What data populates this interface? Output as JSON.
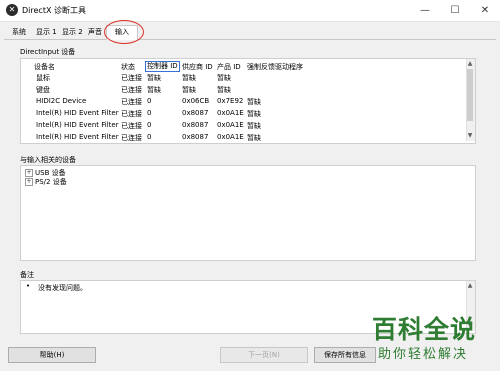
{
  "window": {
    "title": "DirectX 诊断工具",
    "minimize": "—",
    "maximize": "☐",
    "close": "✕"
  },
  "tabs": [
    {
      "label": "系统"
    },
    {
      "label": "显示 1"
    },
    {
      "label": "显示 2"
    },
    {
      "label": "声音"
    },
    {
      "label": "输入"
    }
  ],
  "directinput": {
    "group_title": "DirectInput 设备",
    "columns": [
      "设备名",
      "状态",
      "控制器 ID",
      "供应商 ID",
      "产品 ID",
      "强制反馈驱动程序"
    ],
    "rows": [
      [
        "鼠标",
        "已连接",
        "暂缺",
        "暂缺",
        "暂缺",
        ""
      ],
      [
        "键盘",
        "已连接",
        "暂缺",
        "暂缺",
        "暂缺",
        ""
      ],
      [
        "HIDI2C Device",
        "已连接",
        "0",
        "0x06CB",
        "0x7E92",
        "暂缺"
      ],
      [
        "Intel(R) HID Event Filter",
        "已连接",
        "0",
        "0x8087",
        "0x0A1E",
        "暂缺"
      ],
      [
        "Intel(R) HID Event Filter",
        "已连接",
        "0",
        "0x8087",
        "0x0A1E",
        "暂缺"
      ],
      [
        "Intel(R) HID Event Filter",
        "已连接",
        "0",
        "0x8087",
        "0x0A1E",
        "暂缺"
      ]
    ]
  },
  "related": {
    "group_title": "与输入相关的设备",
    "items": [
      {
        "toggle": "+",
        "label": "USB 设备"
      },
      {
        "toggle": "+",
        "label": "PS/2 设备"
      }
    ]
  },
  "notes": {
    "group_title": "备注",
    "bullet": "•",
    "text": "没有发现问题。"
  },
  "buttons": {
    "help": "帮助(H)",
    "next": "下一页(N)",
    "save": "保存所有信息"
  },
  "watermark": {
    "main": "百科全说",
    "sub": "助你轻松解决"
  },
  "colors": {
    "highlight_circle": "#d93025",
    "watermark": "#2e7d32"
  }
}
